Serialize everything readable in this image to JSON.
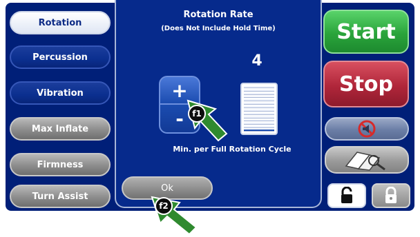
{
  "sidebar": {
    "items": [
      {
        "label": "Rotation"
      },
      {
        "label": "Percussion"
      },
      {
        "label": "Vibration"
      },
      {
        "label": "Max Inflate"
      },
      {
        "label": "Firmness"
      },
      {
        "label": "Turn Assist"
      }
    ]
  },
  "dialog": {
    "title": "Rotation Rate",
    "subtitle": "(Does Not Include Hold Time)",
    "value": "4",
    "caption": "Min. per Full Rotation Cycle",
    "plus_label": "+",
    "minus_label": "-",
    "ok_label": "Ok",
    "level_fraction": 0.07
  },
  "actions": {
    "start_label": "Start",
    "stop_label": "Stop"
  },
  "callouts": {
    "f1": "f1",
    "f2": "f2"
  },
  "colors": {
    "background": "#001f78",
    "start": "#2aa43b",
    "stop": "#b0263a",
    "arrow": "#2f8a2f"
  }
}
